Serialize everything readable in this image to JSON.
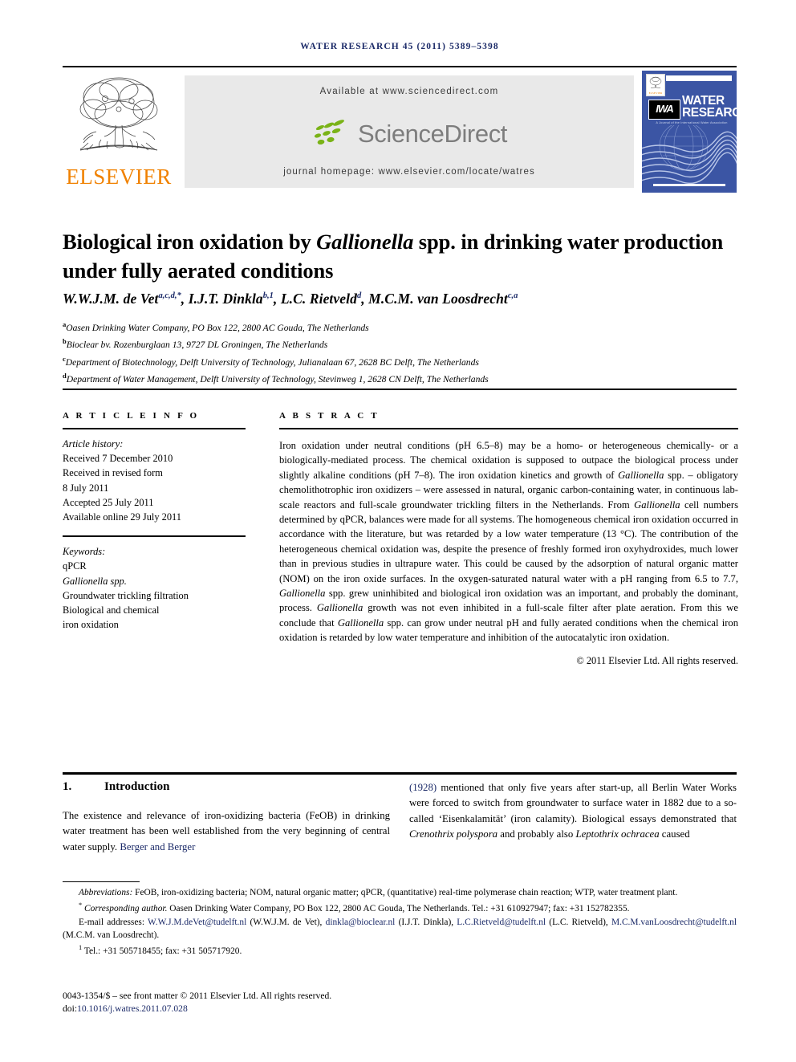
{
  "running_head": "WATER RESEARCH 45 (2011) 5389–5398",
  "masthead": {
    "publisher_name": "ELSEVIER",
    "available_at": "Available at www.sciencedirect.com",
    "sciencedirect_word": "ScienceDirect",
    "journal_homepage": "journal homepage: www.elsevier.com/locate/watres",
    "cover": {
      "society_badge": "IWA",
      "title_line1": "WATER",
      "title_line2": "RESEARCH",
      "tagline": "A Journal of the International Water Association",
      "elsevier_mini": "ELSEVIER",
      "bg_color": "#3b55a4"
    }
  },
  "article": {
    "title_part1": "Biological iron oxidation by ",
    "title_italic": "Gallionella",
    "title_part2": " spp. in drinking water production under fully aerated conditions",
    "authors": [
      {
        "name": "W.W.J.M. de Vet",
        "sup": "a,c,d,*"
      },
      {
        "name": "I.J.T. Dinkla",
        "sup": "b,1"
      },
      {
        "name": "L.C. Rietveld",
        "sup": "d"
      },
      {
        "name": "M.C.M. van Loosdrecht",
        "sup": "c,a"
      }
    ],
    "affiliations": [
      {
        "marker": "a",
        "text": "Oasen Drinking Water Company, PO Box 122, 2800 AC Gouda, The Netherlands"
      },
      {
        "marker": "b",
        "text": "Bioclear bv. Rozenburglaan 13, 9727 DL Groningen, The Netherlands"
      },
      {
        "marker": "c",
        "text": "Department of Biotechnology, Delft University of Technology, Julianalaan 67, 2628 BC Delft, The Netherlands"
      },
      {
        "marker": "d",
        "text": "Department of Water Management, Delft University of Technology, Stevinweg 1, 2628 CN Delft, The Netherlands"
      }
    ]
  },
  "article_info": {
    "heading": "A R T I C L E   I N F O",
    "history_label": "Article history:",
    "history": [
      "Received 7 December 2010",
      "Received in revised form",
      "8 July 2011",
      "Accepted 25 July 2011",
      "Available online 29 July 2011"
    ],
    "keywords_label": "Keywords:",
    "keywords": [
      "qPCR",
      "Gallionella spp.",
      "Groundwater trickling filtration",
      "Biological and chemical",
      "iron oxidation"
    ]
  },
  "abstract": {
    "heading": "A B S T R A C T",
    "paragraph_1": "Iron oxidation under neutral conditions (pH 6.5–8) may be a homo- or heterogeneous chemically- or a biologically-mediated process. The chemical oxidation is supposed to outpace the biological process under slightly alkaline conditions (pH 7–8). The iron oxidation kinetics and growth of ",
    "italic_1": "Gallionella",
    "paragraph_2": " spp. – obligatory chemolithotrophic iron oxidizers – were assessed in natural, organic carbon-containing water, in continuous lab-scale reactors and full-scale groundwater trickling filters in the Netherlands. From ",
    "italic_2": "Gallionella",
    "paragraph_3": " cell numbers determined by qPCR, balances were made for all systems. The homogeneous chemical iron oxidation occurred in accordance with the literature, but was retarded by a low water temperature (13 °C). The contribution of the heterogeneous chemical oxidation was, despite the presence of freshly formed iron oxyhydroxides, much lower than in previous studies in ultrapure water. This could be caused by the adsorption of natural organic matter (NOM) on the iron oxide surfaces. In the oxygen-saturated natural water with a pH ranging from 6.5 to 7.7, ",
    "italic_3": "Gallionella",
    "paragraph_4": " spp. grew uninhibited and biological iron oxidation was an important, and probably the dominant, process. ",
    "italic_4": "Gallionella",
    "paragraph_5": " growth was not even inhibited in a full-scale filter after plate aeration. From this we conclude that ",
    "italic_5": "Gallionella",
    "paragraph_6": " spp. can grow under neutral pH and fully aerated conditions when the chemical iron oxidation is retarded by low water temperature and inhibition of the autocatalytic iron oxidation.",
    "copyright": "© 2011 Elsevier Ltd. All rights reserved."
  },
  "introduction": {
    "number": "1.",
    "title": "Introduction",
    "left_text_1": "The existence and relevance of iron-oxidizing bacteria (FeOB) in drinking water treatment has been well established from the very beginning of central water supply. ",
    "left_citation": "Berger and Berger",
    "right_citation": "(1928)",
    "right_text_1": " mentioned that only five years after start-up, all Berlin Water Works were forced to switch from groundwater to surface water in 1882 due to a so-called ‘Eisenkalamität’ (iron calamity). Biological essays demonstrated that ",
    "right_italic_1": "Crenothrix polyspora",
    "right_text_2": " and probably also ",
    "right_italic_2": "Leptothrix ochracea",
    "right_text_3": " caused"
  },
  "footnotes": {
    "abbrev_label": "Abbreviations:",
    "abbrev_text": " FeOB, iron-oxidizing bacteria; NOM, natural organic matter; qPCR, (quantitative) real-time polymerase chain reaction; WTP, water treatment plant.",
    "corresponding_marker": "*",
    "corresponding_label": "Corresponding author.",
    "corresponding_text": " Oasen Drinking Water Company, PO Box 122, 2800 AC Gouda, The Netherlands. Tel.: +31 610927947; fax: +31 152782355.",
    "email_label": "E-mail addresses:",
    "emails": [
      {
        "address": "W.W.J.M.deVet@tudelft.nl",
        "owner": " (W.W.J.M. de Vet), "
      },
      {
        "address": "dinkla@bioclear.nl",
        "owner": " (I.J.T. Dinkla), "
      },
      {
        "address": "L.C.Rietveld@tudelft.nl",
        "owner": " (L.C. Rietveld), "
      },
      {
        "address": "M.C.M.vanLoosdrecht@tudelft.nl",
        "owner": " (M.C.M. van Loosdrecht)."
      }
    ],
    "note1_marker": "1",
    "note1_text": " Tel.: +31 505718455; fax: +31 505717920.",
    "issn_line": "0043-1354/$ – see front matter © 2011 Elsevier Ltd. All rights reserved.",
    "doi_prefix": "doi:",
    "doi_value": "10.1016/j.watres.2011.07.028"
  }
}
